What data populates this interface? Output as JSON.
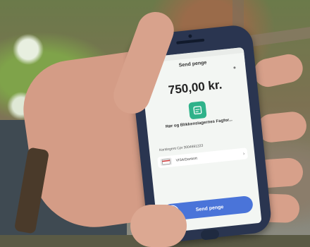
{
  "app": {
    "nav_title": "Send penge",
    "back_glyph": "‹",
    "amount": "750,00 kr.",
    "app_icon": "receipt-icon",
    "recipient": "Rør og Blikkenslagernes Fagfor...",
    "recipient_sub": "",
    "reference": "Kontingent Cpr 3004691223",
    "payment_card": "VISA/Dankort",
    "card_chevron": "›",
    "send_button": "Send penge",
    "send_knob_glyph": "›"
  },
  "colors": {
    "accent": "#2fb28a",
    "button": "#4a74d9",
    "phone_body": "#2a3550"
  }
}
